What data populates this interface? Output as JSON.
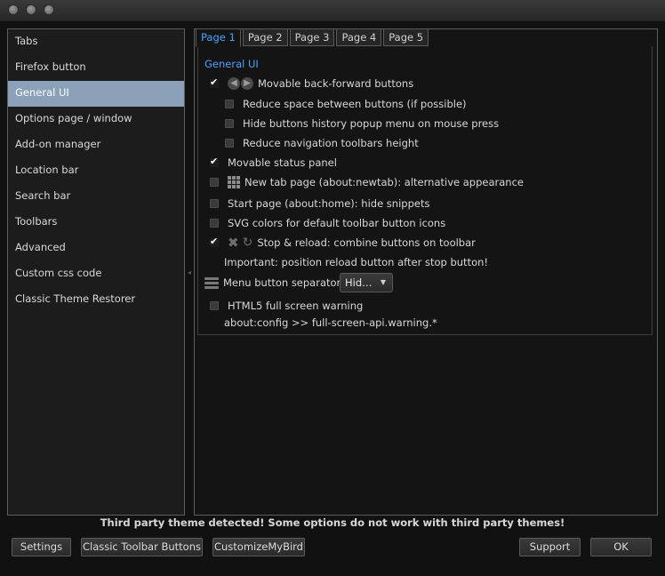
{
  "sidebar": {
    "items": [
      {
        "label": "Tabs",
        "selected": false
      },
      {
        "label": "Firefox button",
        "selected": false
      },
      {
        "label": "General UI",
        "selected": true
      },
      {
        "label": "Options page / window",
        "selected": false
      },
      {
        "label": "Add-on manager",
        "selected": false
      },
      {
        "label": "Location bar",
        "selected": false
      },
      {
        "label": "Search bar",
        "selected": false
      },
      {
        "label": "Toolbars",
        "selected": false
      },
      {
        "label": "Advanced",
        "selected": false
      },
      {
        "label": "Custom css code",
        "selected": false
      },
      {
        "label": "Classic Theme Restorer",
        "selected": false
      }
    ]
  },
  "tabs": [
    "Page 1",
    "Page 2",
    "Page 3",
    "Page 4",
    "Page 5"
  ],
  "active_tab": "Page 1",
  "section_title": "General UI",
  "options": {
    "movable_back_forward": {
      "label": "Movable back-forward buttons",
      "checked": true
    },
    "reduce_space": {
      "label": "Reduce space between buttons (if possible)",
      "checked": false
    },
    "hide_history_popup": {
      "label": "Hide buttons history popup menu on mouse press",
      "checked": false
    },
    "reduce_nav_height": {
      "label": "Reduce navigation toolbars height",
      "checked": false
    },
    "movable_status_panel": {
      "label": "Movable status panel",
      "checked": true
    },
    "new_tab_page": {
      "label": "New tab page (about:newtab): alternative appearance",
      "checked": false
    },
    "start_page": {
      "label": "Start page (about:home): hide snippets",
      "checked": false
    },
    "svg_colors": {
      "label": "SVG colors for default toolbar button icons",
      "checked": false
    },
    "stop_reload": {
      "label": "Stop & reload: combine buttons on toolbar",
      "checked": true
    },
    "stop_reload_note": "Important: position reload button after stop button!",
    "menu_separator_label": "Menu button separator",
    "menu_separator_value": "Hid…",
    "html5_fullscreen": {
      "label": "HTML5 full screen warning",
      "checked": false
    },
    "html5_note": "about:config >> full-screen-api.warning.*"
  },
  "warning": "Third party theme detected! Some options do not work with third party themes!",
  "buttons": {
    "settings": "Settings",
    "classic_toolbar": "Classic Toolbar Buttons",
    "customize": "CustomizeMyBird",
    "support": "Support",
    "ok": "OK"
  },
  "icons": {
    "back": "back-arrow-icon",
    "forward": "forward-arrow-icon",
    "new_tab_grid": "grid-icon",
    "stop": "stop-icon",
    "reload": "reload-icon",
    "menu": "menu-icon"
  },
  "colors": {
    "accent": "#4aa3ff",
    "selected_sidebar": "#8aa1b9"
  }
}
